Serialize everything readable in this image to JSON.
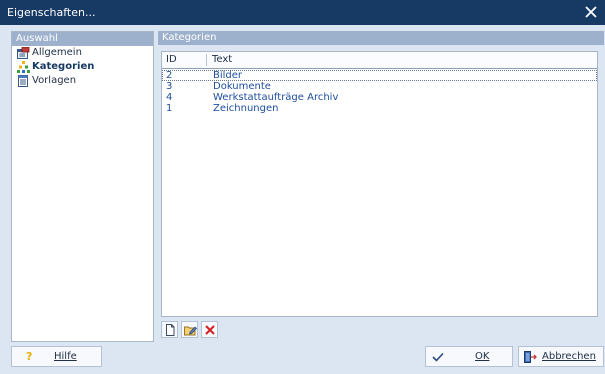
{
  "window": {
    "title": "Eigenschaften..."
  },
  "left_panel": {
    "header": "Auswahl",
    "items": [
      {
        "label": "Allgemein",
        "icon": "properties-icon",
        "active": false
      },
      {
        "label": "Kategorien",
        "icon": "categories-icon",
        "active": true
      },
      {
        "label": "Vorlagen",
        "icon": "templates-icon",
        "active": false
      }
    ]
  },
  "right_panel": {
    "header": "Kategorien",
    "table": {
      "columns": [
        "ID",
        "Text"
      ],
      "rows": [
        {
          "id": "2",
          "text": "Bilder",
          "selected": true
        },
        {
          "id": "3",
          "text": "Dokumente",
          "selected": false
        },
        {
          "id": "4",
          "text": "Werkstattaufträge Archiv",
          "selected": false
        },
        {
          "id": "1",
          "text": "Zeichnungen",
          "selected": false
        }
      ]
    },
    "toolbar": [
      "new-icon",
      "edit-icon",
      "delete-icon"
    ]
  },
  "footer": {
    "help_label": "Hilfe",
    "ok_label": "OK",
    "cancel_label": "Abbrechen"
  },
  "colors": {
    "titlebar": "#173a64",
    "panel_header": "#9db1cc",
    "background": "#dce6f2",
    "link_text": "#1f4fa0",
    "delete_red": "#d42020"
  }
}
